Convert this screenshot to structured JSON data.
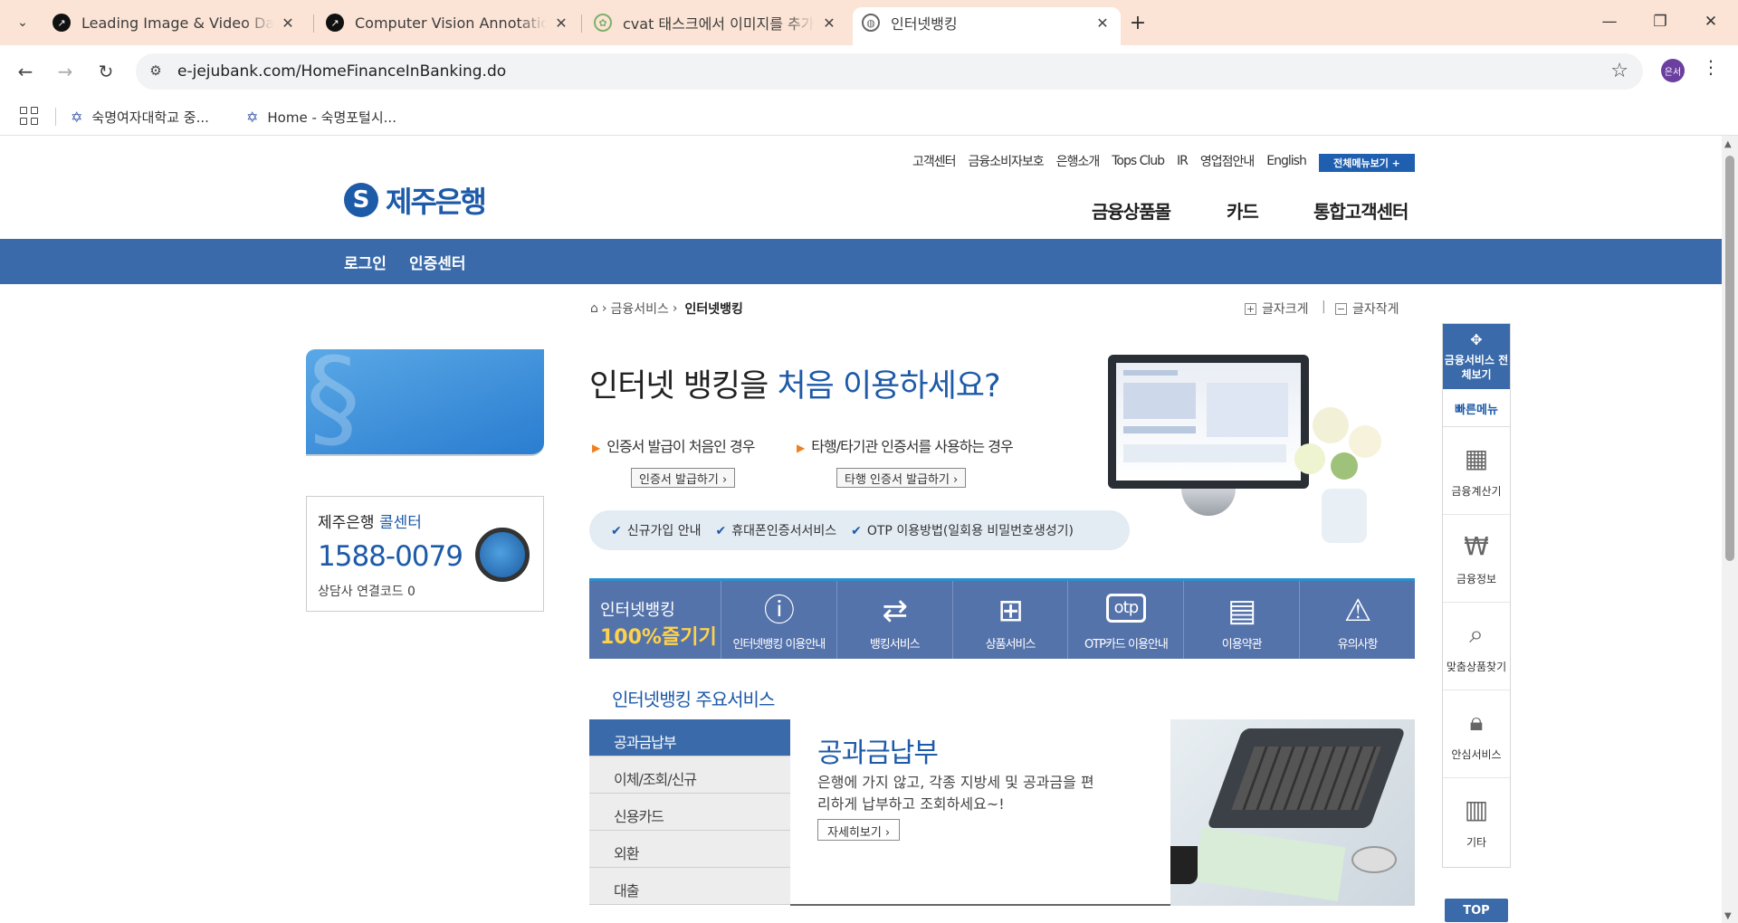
{
  "browser": {
    "tabs": [
      {
        "title": "Leading Image & Video Data A",
        "favicon": "arrow-up-right-icon",
        "color": "#111111"
      },
      {
        "title": "Computer Vision Annotation T",
        "favicon": "arrow-up-right-icon",
        "color": "#111111"
      },
      {
        "title": "cvat 태스크에서 이미지를 추가",
        "favicon": "chatgpt-icon",
        "color": "#7fb06a"
      },
      {
        "title": "인터넷뱅킹",
        "favicon": "globe-icon",
        "color": "#555555",
        "active": true
      }
    ],
    "url": "e-jejubank.com/HomeFinanceInBanking.do",
    "profile": "은서",
    "bookmarks": [
      {
        "label": "숙명여자대학교 중...",
        "icon": "star-of-david-icon"
      },
      {
        "label": "Home - 숙명포털시...",
        "icon": "star-of-david-icon"
      }
    ]
  },
  "site": {
    "util_links": [
      "고객센터",
      "금융소비자보호",
      "은행소개",
      "Tops Club",
      "IR",
      "영업점안내",
      "English"
    ],
    "all_menu": "전체메뉴보기 +",
    "logo": "제주은행",
    "gnb": [
      "금융상품몰",
      "카드",
      "통합고객센터"
    ],
    "bar_links": [
      "로그인",
      "인증센터"
    ],
    "breadcrumb": {
      "home": "⌂",
      "parent": "금융서비스",
      "current": "인터넷뱅킹"
    },
    "font_bigger": "글자크게",
    "font_smaller": "글자작게",
    "call": {
      "title": "제주은행",
      "title_hl": "콜센터",
      "number": "1588-0079",
      "code": "상담사 연결코드 0"
    },
    "hero": {
      "title": "인터넷 뱅킹을 ",
      "title_hl": "처음 이용하세요?",
      "sub1": "인증서 발급이 처음인 경우",
      "btn1": "인증서 발급하기 ›",
      "sub2": "타행/타기관 인증서를 사용하는 경우",
      "btn2": "타행 인증서 발급하기 ›",
      "checks": [
        "신규가입 안내",
        "휴대폰인증서서비스",
        "OTP 이용방법(일회용 비밀번호생성기)"
      ]
    },
    "iconbar": {
      "lead_a": "인터넷뱅킹",
      "lead_b": "100%즐기기",
      "items": [
        {
          "label": "인터넷뱅킹 이용안내",
          "icon": "info-icon"
        },
        {
          "label": "뱅킹서비스",
          "icon": "transfer-icon"
        },
        {
          "label": "상품서비스",
          "icon": "gift-icon"
        },
        {
          "label": "OTP카드 이용안내",
          "icon": "otp-icon"
        },
        {
          "label": "이용약관",
          "icon": "clipboard-icon"
        },
        {
          "label": "유의사항",
          "icon": "warning-icon"
        }
      ]
    },
    "services": {
      "title": "인터넷뱅킹 ",
      "title_hl": "주요서비스",
      "menu": [
        "공과금납부",
        "이체/조회/신규",
        "신용카드",
        "외환",
        "대출"
      ],
      "panel_title": "공과금납부",
      "panel_desc": "은행에 가지 않고, 각종 지방세 및 공과금을 편리하게 납부하고 조회하세요~!",
      "more": "자세히보기 ›"
    },
    "quick": {
      "head": "금융서비스 전체보기",
      "fast": "빠른메뉴",
      "items": [
        "금융계산기",
        "금융정보",
        "맞춤상품찾기",
        "안심서비스",
        "기타"
      ]
    },
    "top": "TOP"
  }
}
